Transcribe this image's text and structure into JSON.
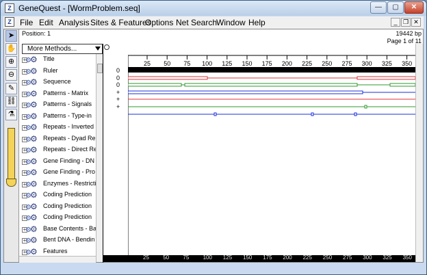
{
  "window": {
    "title": "GeneQuest - [WormProblem.seq]",
    "app_icon_label": "Z",
    "controls": {
      "minimize": "—",
      "maximize": "▢",
      "close": "✕"
    }
  },
  "menu": {
    "items": [
      "File",
      "Edit",
      "Analysis",
      "Sites & Features",
      "Options",
      "Net Search",
      "Window",
      "Help"
    ],
    "mdi_controls": {
      "minimize": "_",
      "restore": "❐",
      "close": "✕"
    }
  },
  "info": {
    "position": "Position: 1",
    "length": "19442 bp",
    "page": "Page 1 of 11"
  },
  "methods_dropdown": {
    "value": "More Methods..."
  },
  "methods_list": [
    "Title",
    "Ruler",
    "Sequence",
    "Patterns - Matrix",
    "Patterns - Signals",
    "Patterns - Type-in",
    "Repeats - Inverted",
    "Repeats - Dyad Re",
    "Repeats - Direct Re",
    "Gene Finding - DN",
    "Gene Finding - Pro",
    "Enzymes - Restricti",
    "Coding Prediction",
    "Coding Prediction",
    "Coding Prediction",
    "Base Contents - Ba",
    "Bent DNA - Bendin",
    "Features"
  ],
  "tracks": {
    "labels": [
      "0",
      "0",
      "0",
      "+",
      "+",
      "+"
    ],
    "colors": [
      "#e0303a",
      "#2e9a2e",
      "#1a2fd8",
      "#e0303a",
      "#2e9a2e",
      "#1a2fd8"
    ]
  },
  "ruler": {
    "ticks": [
      "25",
      "50",
      "75",
      "100",
      "125",
      "150",
      "175",
      "200",
      "225",
      "250",
      "275",
      "300",
      "325",
      "350"
    ]
  },
  "colors": {
    "ruler_bar": "#000000",
    "window_frame": "#c9daf0"
  }
}
